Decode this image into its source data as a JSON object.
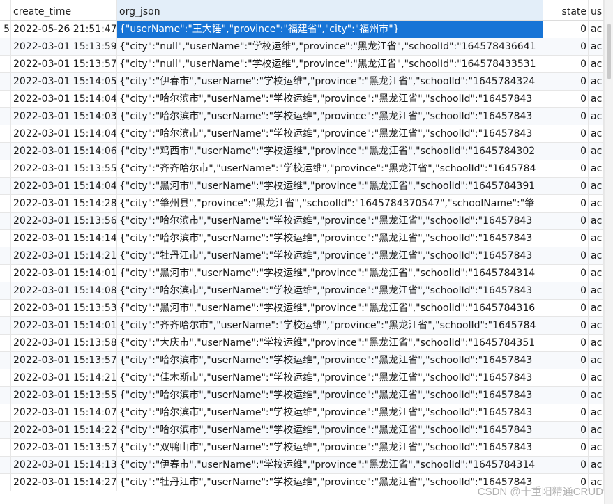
{
  "columns": {
    "c0": "",
    "c1": "create_time",
    "c2": "org_json",
    "c3": "state",
    "c4": "us"
  },
  "rows": [
    {
      "c0": "5",
      "c1": "2022-05-26 21:51:47",
      "c2": "{\"userName\":\"王大锤\",\"province\":\"福建省\",\"city\":\"福州市\"}",
      "c3": "0",
      "c4": "ac"
    },
    {
      "c0": "",
      "c1": "2022-03-01 15:13:59",
      "c2": "{\"city\":\"null\",\"userName\":\"学校运维\",\"province\":\"黑龙江省\",\"schoolId\":\"164578436641",
      "c3": "0",
      "c4": "ac"
    },
    {
      "c0": "",
      "c1": "2022-03-01 15:13:57",
      "c2": "{\"city\":\"null\",\"userName\":\"学校运维\",\"province\":\"黑龙江省\",\"schoolId\":\"164578433531",
      "c3": "0",
      "c4": "ac"
    },
    {
      "c0": "",
      "c1": "2022-03-01 15:14:05",
      "c2": "{\"city\":\"伊春市\",\"userName\":\"学校运维\",\"province\":\"黑龙江省\",\"schoolId\":\"1645784324",
      "c3": "0",
      "c4": "ac"
    },
    {
      "c0": "",
      "c1": "2022-03-01 15:14:04",
      "c2": "{\"city\":\"哈尔滨市\",\"userName\":\"学校运维\",\"province\":\"黑龙江省\",\"schoolId\":\"16457843",
      "c3": "0",
      "c4": "ac"
    },
    {
      "c0": "",
      "c1": "2022-03-01 15:14:03",
      "c2": "{\"city\":\"哈尔滨市\",\"userName\":\"学校运维\",\"province\":\"黑龙江省\",\"schoolId\":\"16457843",
      "c3": "0",
      "c4": "ac"
    },
    {
      "c0": "",
      "c1": "2022-03-01 15:14:04",
      "c2": "{\"city\":\"哈尔滨市\",\"userName\":\"学校运维\",\"province\":\"黑龙江省\",\"schoolId\":\"16457843",
      "c3": "0",
      "c4": "ac"
    },
    {
      "c0": "",
      "c1": "2022-03-01 15:14:06",
      "c2": "{\"city\":\"鸡西市\",\"userName\":\"学校运维\",\"province\":\"黑龙江省\",\"schoolId\":\"1645784302",
      "c3": "0",
      "c4": "ac"
    },
    {
      "c0": "",
      "c1": "2022-03-01 15:13:55",
      "c2": "{\"city\":\"齐齐哈尔市\",\"userName\":\"学校运维\",\"province\":\"黑龙江省\",\"schoolId\":\"1645784",
      "c3": "0",
      "c4": "ac"
    },
    {
      "c0": "",
      "c1": "2022-03-01 15:14:04",
      "c2": "{\"city\":\"黑河市\",\"userName\":\"学校运维\",\"province\":\"黑龙江省\",\"schoolId\":\"1645784391",
      "c3": "0",
      "c4": "ac"
    },
    {
      "c0": "",
      "c1": "2022-03-01 15:14:28",
      "c2": "{\"city\":\"肇州县\",\"province\":\"黑龙江省\",\"schoolId\":\"1645784370547\",\"schoolName\":\"肇",
      "c3": "0",
      "c4": "ac"
    },
    {
      "c0": "",
      "c1": "2022-03-01 15:13:56",
      "c2": "{\"city\":\"哈尔滨市\",\"userName\":\"学校运维\",\"province\":\"黑龙江省\",\"schoolId\":\"16457843",
      "c3": "0",
      "c4": "ac"
    },
    {
      "c0": "",
      "c1": "2022-03-01 15:14:14",
      "c2": "{\"city\":\"哈尔滨市\",\"userName\":\"学校运维\",\"province\":\"黑龙江省\",\"schoolId\":\"16457843",
      "c3": "0",
      "c4": "ac"
    },
    {
      "c0": "",
      "c1": "2022-03-01 15:14:21",
      "c2": "{\"city\":\"牡丹江市\",\"userName\":\"学校运维\",\"province\":\"黑龙江省\",\"schoolId\":\"16457843",
      "c3": "0",
      "c4": "ac"
    },
    {
      "c0": "",
      "c1": "2022-03-01 15:14:01",
      "c2": "{\"city\":\"黑河市\",\"userName\":\"学校运维\",\"province\":\"黑龙江省\",\"schoolId\":\"1645784314",
      "c3": "0",
      "c4": "ac"
    },
    {
      "c0": "",
      "c1": "2022-03-01 15:14:08",
      "c2": "{\"city\":\"哈尔滨市\",\"userName\":\"学校运维\",\"province\":\"黑龙江省\",\"schoolId\":\"16457843",
      "c3": "0",
      "c4": "ac"
    },
    {
      "c0": "",
      "c1": "2022-03-01 15:13:53",
      "c2": "{\"city\":\"黑河市\",\"userName\":\"学校运维\",\"province\":\"黑龙江省\",\"schoolId\":\"1645784316",
      "c3": "0",
      "c4": "ac"
    },
    {
      "c0": "",
      "c1": "2022-03-01 15:14:01",
      "c2": "{\"city\":\"齐齐哈尔市\",\"userName\":\"学校运维\",\"province\":\"黑龙江省\",\"schoolId\":\"1645784",
      "c3": "0",
      "c4": "ac"
    },
    {
      "c0": "",
      "c1": "2022-03-01 15:13:58",
      "c2": "{\"city\":\"大庆市\",\"userName\":\"学校运维\",\"province\":\"黑龙江省\",\"schoolId\":\"1645784351",
      "c3": "0",
      "c4": "ac"
    },
    {
      "c0": "",
      "c1": "2022-03-01 15:13:57",
      "c2": "{\"city\":\"哈尔滨市\",\"userName\":\"学校运维\",\"province\":\"黑龙江省\",\"schoolId\":\"16457843",
      "c3": "0",
      "c4": "ac"
    },
    {
      "c0": "",
      "c1": "2022-03-01 15:14:21",
      "c2": "{\"city\":\"佳木斯市\",\"userName\":\"学校运维\",\"province\":\"黑龙江省\",\"schoolId\":\"16457843",
      "c3": "0",
      "c4": "ac"
    },
    {
      "c0": "",
      "c1": "2022-03-01 15:13:55",
      "c2": "{\"city\":\"哈尔滨市\",\"userName\":\"学校运维\",\"province\":\"黑龙江省\",\"schoolId\":\"16457843",
      "c3": "0",
      "c4": "ac"
    },
    {
      "c0": "",
      "c1": "2022-03-01 15:14:07",
      "c2": "{\"city\":\"哈尔滨市\",\"userName\":\"学校运维\",\"province\":\"黑龙江省\",\"schoolId\":\"16457843",
      "c3": "0",
      "c4": "ac"
    },
    {
      "c0": "",
      "c1": "2022-03-01 15:14:22",
      "c2": "{\"city\":\"哈尔滨市\",\"userName\":\"学校运维\",\"province\":\"黑龙江省\",\"schoolId\":\"16457843",
      "c3": "0",
      "c4": "ac"
    },
    {
      "c0": "",
      "c1": "2022-03-01 15:13:57",
      "c2": "{\"city\":\"双鸭山市\",\"userName\":\"学校运维\",\"province\":\"黑龙江省\",\"schoolId\":\"16457843",
      "c3": "0",
      "c4": "ac"
    },
    {
      "c0": "",
      "c1": "2022-03-01 15:14:13",
      "c2": "{\"city\":\"伊春市\",\"userName\":\"学校运维\",\"province\":\"黑龙江省\",\"schoolId\":\"1645784314",
      "c3": "0",
      "c4": "ac"
    },
    {
      "c0": "",
      "c1": "2022-03-01 15:14:27",
      "c2": "{\"city\":\"牡丹江市\",\"userName\":\"学校运维\",\"province\":\"黑龙江省\",\"schoolId\":\"16457843",
      "c3": "0",
      "c4": "ac"
    }
  ],
  "watermark": "CSDN @十重阳精通CRUD",
  "colors": {
    "selection": "#1774d6",
    "active_header": "#e3eef9",
    "alt_row": "#f7f9fc"
  }
}
